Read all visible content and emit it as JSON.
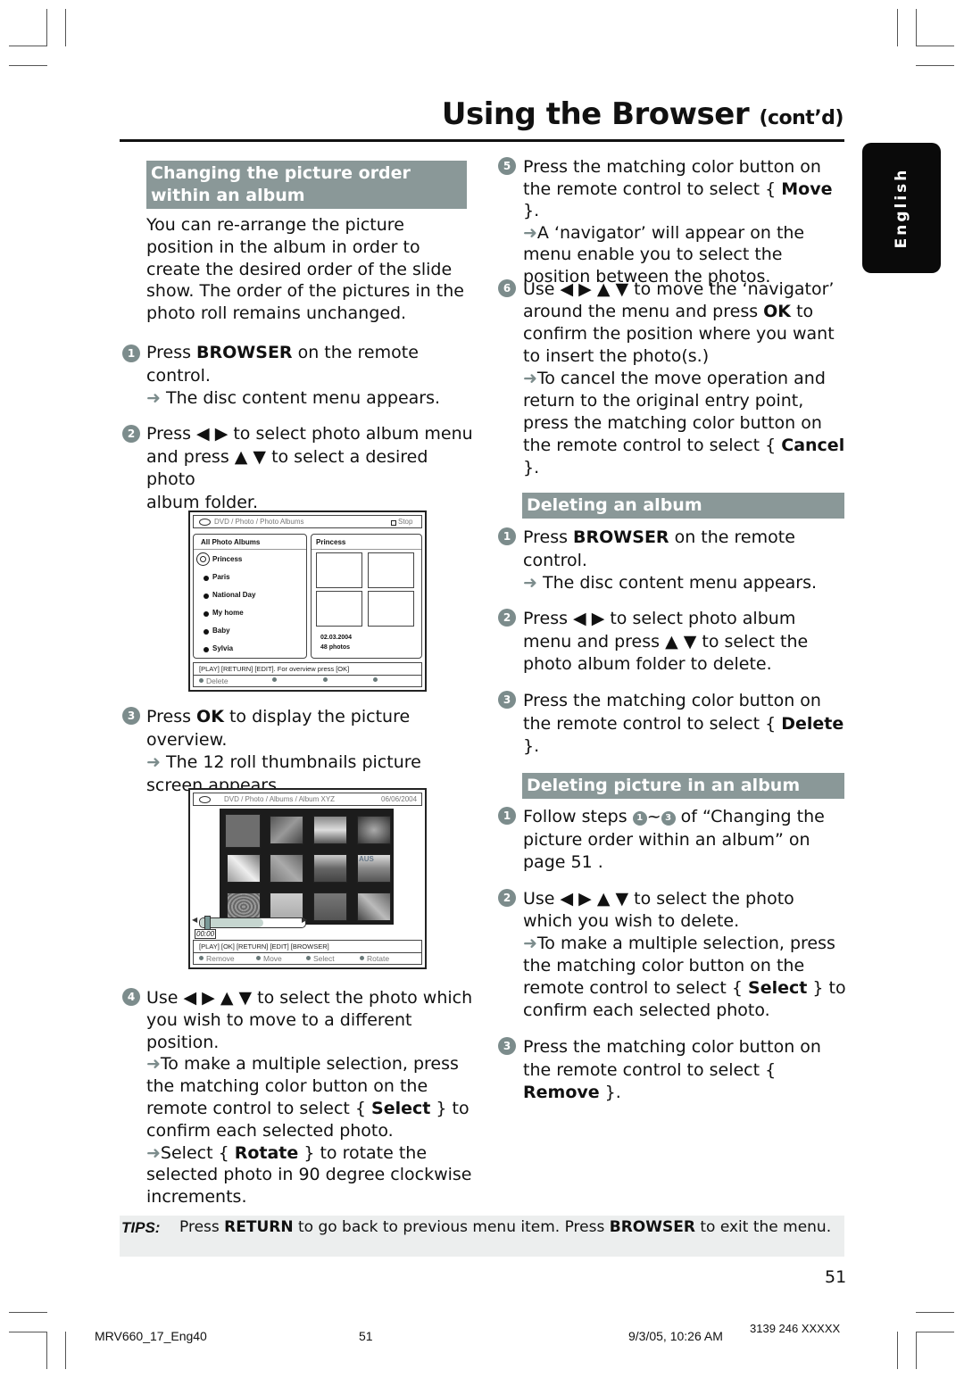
{
  "header": {
    "title": "Using the Browser",
    "title_suffix": "(cont’d)",
    "language_tab": "English"
  },
  "left": {
    "section_title": "Changing the picture order within an album",
    "intro": "You can re-arrange the picture position in the album in order to create the desired order of the slide show. The order of the pictures in the photo roll remains unchanged.",
    "steps": [
      {
        "num": "1",
        "pre": "Press ",
        "bold": "BROWSER",
        "post": " on the remote control.",
        "result": "The disc content menu appears."
      },
      {
        "num": "2",
        "line1": "Press ◀ ▶ to select photo album menu",
        "line2": "and press ▲ ▼ to select a desired photo",
        "line3": "album folder."
      },
      {
        "num": "3",
        "pre": "Press ",
        "bold": "OK",
        "post": " to display the picture overview.",
        "result": "The 12 roll thumbnails picture screen appears."
      },
      {
        "num": "4",
        "line1": "Use ◀ ▶ ▲ ▼  to select the photo which",
        "line2": "you wish to move to a different position.",
        "result1_pre": "To make a multiple selection, press the matching color button on the remote control to select { ",
        "result1_bold": "Select",
        "result1_post": " } to confirm each selected photo.",
        "result2_pre": "Select { ",
        "result2_bold": "Rotate",
        "result2_post": " } to rotate the selected photo in 90 degree clockwise increments."
      }
    ]
  },
  "screen1": {
    "breadcrumb": "DVD / Photo / Photo Albums",
    "stop_label": "Stop",
    "list_header": "All Photo Albums",
    "albums": [
      "Princess",
      "Paris",
      "National Day",
      "My home",
      "Baby",
      "Sylvia"
    ],
    "selected_album": "Princess",
    "preview_header": "Princess",
    "preview_date": "02.03.2004",
    "preview_count": "48 photos",
    "hint": "[PLAY] [RETURN] [EDIT].  For overview press [OK]",
    "buttons": [
      "Delete",
      "",
      "",
      ""
    ]
  },
  "screen2": {
    "breadcrumb": "DVD / Photo / Albums / Album XYZ",
    "date": "06/06/2004",
    "thumb_count": 12,
    "thumb_overlay_text": "AUS",
    "time": "00:00",
    "hint": "[PLAY] [OK] [RETURN] [EDIT] [BROWSER]",
    "buttons": [
      "Remove",
      "Move",
      "Select",
      "Rotate"
    ]
  },
  "right": {
    "steps_cont": [
      {
        "num": "5",
        "pre": "Press the matching color button on the remote control to select { ",
        "bold": "Move",
        "post": " }.",
        "result": "A ‘navigator’ will appear on the menu enable you to select the position between the photos."
      },
      {
        "num": "6",
        "pre": "Use ◀ ▶ ▲ ▼  to move the ‘navigator’ around the menu and press ",
        "bold": "OK",
        "post": " to confirm the position where you want to insert the photo(s.)",
        "result_pre": "To cancel the move operation and return to the original entry point, press the matching color button on the remote control to select { ",
        "result_bold": "Cancel",
        "result_post": " }."
      }
    ],
    "delete_album": {
      "title": "Deleting an album",
      "steps": [
        {
          "num": "1",
          "pre": "Press ",
          "bold": "BROWSER",
          "post": " on the remote control.",
          "result": "The disc content menu appears."
        },
        {
          "num": "2",
          "text": "Press ◀ ▶ to select photo album menu and press ▲ ▼ to select the photo album folder to delete."
        },
        {
          "num": "3",
          "pre": "Press the matching color button on the remote control to select { ",
          "bold": "Delete",
          "post": " }."
        }
      ]
    },
    "delete_picture": {
      "title": "Deleting picture in an album",
      "steps": [
        {
          "num": "1",
          "pre": "Follow steps ",
          "ref_from": "1",
          "tilde": "~",
          "ref_to": "3",
          "post": " of “Changing the picture order within an album” on page 51 ."
        },
        {
          "num": "2",
          "text": "Use ◀ ▶ ▲ ▼  to select the photo which you wish to delete.",
          "result_pre": "To make a multiple selection, press the matching color button on the remote control to select { ",
          "result_bold": "Select",
          "result_post": " } to confirm each selected photo."
        },
        {
          "num": "3",
          "pre": "Press the matching color button on the remote control to select { ",
          "bold": "Remove",
          "post": " }."
        }
      ]
    }
  },
  "tips": {
    "label": "TIPS:",
    "pre1": "Press ",
    "bold1": "RETURN",
    "mid": " to go back to previous menu item.  Press ",
    "bold2": "BROWSER",
    "post": " to exit the menu."
  },
  "page_number": "51",
  "footer": {
    "file": "MRV660_17_Eng40",
    "page": "51",
    "datetime": "9/3/05, 10:26 AM",
    "code": "3139 246 XXXXX"
  },
  "arrow_glyph": "➜"
}
